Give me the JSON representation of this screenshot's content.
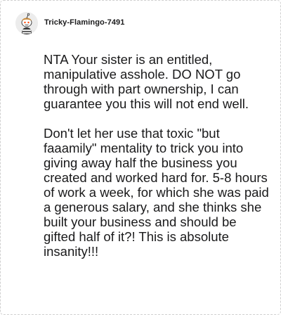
{
  "comment": {
    "username": "Tricky-Flamingo-7491",
    "avatar_icon": "reddit-snoo-avatar-icon",
    "paragraphs": [
      "NTA Your sister is an entitled, manipulative asshole. DO NOT go through with part ownership, I can guarantee you this will not end well.",
      "Don't let her use that toxic \"but faaamily\" mentality to trick you into giving away half the business you created and worked hard for. 5-8 hours of work a week, for which she was paid a generous salary, and she thinks she built your business and should be gifted half of it?! This is absolute insanity!!!"
    ]
  },
  "colors": {
    "text": "#1a1a1b",
    "border": "#cfcfcf",
    "background": "#ffffff"
  }
}
